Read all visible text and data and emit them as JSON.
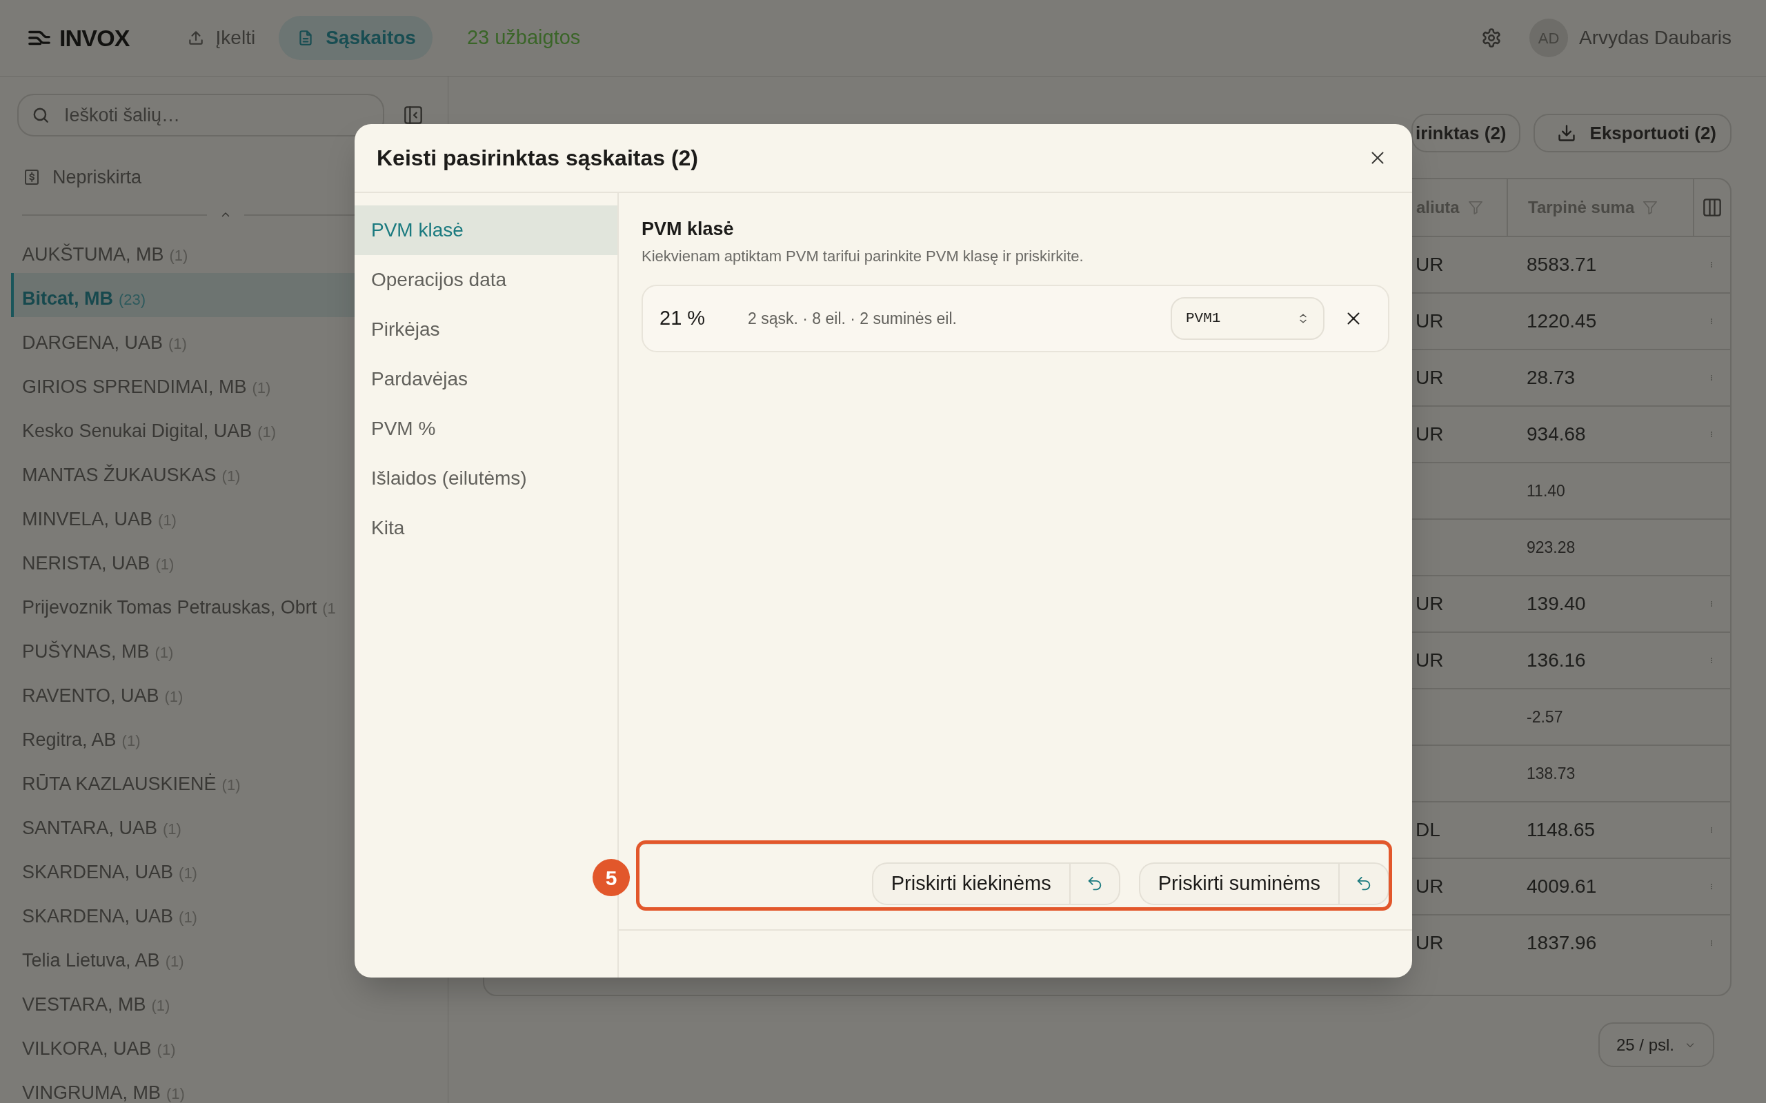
{
  "top_bar": {
    "logo": "INVOX",
    "nav": [
      {
        "label": "Įkelti",
        "kind": "upload",
        "selected": false
      },
      {
        "label": "Sąskaitos",
        "kind": "invoices",
        "selected": true
      }
    ],
    "status": "23 užbaigtos",
    "user": {
      "initials": "AD",
      "name": "Arvydas Daubaris"
    }
  },
  "sidebar": {
    "search": {
      "placeholder": "Ieškoti šalių…"
    },
    "unassigned": {
      "label": "Nepriskirta"
    },
    "items": [
      {
        "name": "AUKŠTUMA, MB",
        "count": "(1)",
        "selected": false
      },
      {
        "name": "Bitcat, MB",
        "count": "(23)",
        "selected": true
      },
      {
        "name": "DARGENA, UAB",
        "count": "(1)",
        "selected": false
      },
      {
        "name": "GIRIOS SPRENDIMAI, MB",
        "count": "(1)",
        "selected": false
      },
      {
        "name": "Kesko Senukai Digital, UAB",
        "count": "(1)",
        "selected": false
      },
      {
        "name": "MANTAS ŽUKAUSKAS",
        "count": "(1)",
        "selected": false
      },
      {
        "name": "MINVELA, UAB",
        "count": "(1)",
        "selected": false
      },
      {
        "name": "NERISTA, UAB",
        "count": "(1)",
        "selected": false
      },
      {
        "name": "Prijevoznik Tomas Petrauskas, Obrt",
        "count": "(1",
        "selected": false
      },
      {
        "name": "PUŠYNAS, MB",
        "count": "(1)",
        "selected": false
      },
      {
        "name": "RAVENTO, UAB",
        "count": "(1)",
        "selected": false
      },
      {
        "name": "Regitra, AB",
        "count": "(1)",
        "selected": false
      },
      {
        "name": "RŪTA KAZLAUSKIENĖ",
        "count": "(1)",
        "selected": false
      },
      {
        "name": "SANTARA, UAB",
        "count": "(1)",
        "selected": false
      },
      {
        "name": "SKARDENA, UAB",
        "count": "(1)",
        "selected": false
      },
      {
        "name": "SKARDENA, UAB",
        "count": "(1)",
        "selected": false
      },
      {
        "name": "Telia Lietuva, AB",
        "count": "(1)",
        "selected": false
      },
      {
        "name": "VESTARA, MB",
        "count": "(1)",
        "selected": false
      },
      {
        "name": "VILKORA, UAB",
        "count": "(1)",
        "selected": false
      },
      {
        "name": "VINGRUMA, MB",
        "count": "(1)",
        "selected": false
      }
    ]
  },
  "toolbar": {
    "buttons": [
      {
        "label": "irinktas (2)",
        "kind": "selection"
      },
      {
        "label": "Eksportuoti (2)",
        "kind": "export"
      }
    ]
  },
  "table": {
    "columns": [
      {
        "label": "aliuta"
      },
      {
        "label": "Tarpinė suma"
      }
    ],
    "rows": [
      {
        "kind": "invoice",
        "currency": "UR",
        "subtotal": "8583.71"
      },
      {
        "kind": "invoice",
        "currency": "UR",
        "subtotal": "1220.45"
      },
      {
        "kind": "invoice",
        "currency": "UR",
        "subtotal": "28.73"
      },
      {
        "kind": "invoice",
        "currency": "UR",
        "subtotal": "934.68"
      },
      {
        "kind": "line",
        "subtotal": "11.40"
      },
      {
        "kind": "line",
        "subtotal": "923.28"
      },
      {
        "kind": "invoice",
        "currency": "UR",
        "subtotal": "139.40"
      },
      {
        "kind": "invoice",
        "currency": "UR",
        "subtotal": "136.16"
      },
      {
        "kind": "line",
        "subtotal": "-2.57"
      },
      {
        "kind": "line",
        "subtotal": "138.73"
      },
      {
        "kind": "invoice",
        "currency": "DL",
        "subtotal": "1148.65"
      },
      {
        "kind": "invoice",
        "currency": "UR",
        "subtotal": "4009.61"
      },
      {
        "kind": "invoice",
        "currency": "UR",
        "subtotal": "1837.96"
      }
    ]
  },
  "pagination": {
    "page_size": "25 / psl."
  },
  "dialog": {
    "title": "Keisti pasirinktas sąskaitas (2)",
    "nav": [
      {
        "label": "PVM klasė",
        "selected": true
      },
      {
        "label": "Operacijos data",
        "selected": false
      },
      {
        "label": "Pirkėjas",
        "selected": false
      },
      {
        "label": "Pardavėjas",
        "selected": false
      },
      {
        "label": "PVM %",
        "selected": false
      },
      {
        "label": "Išlaidos (eilutėms)",
        "selected": false
      },
      {
        "label": "Kita",
        "selected": false
      }
    ],
    "section": {
      "title": "PVM klasė",
      "description": "Kiekvienam aptiktam PVM tarifui parinkite PVM klasę ir priskirkite.",
      "rates": [
        {
          "rate": "21 %",
          "summary": "2 sąsk. · 8 eil. · 2 suminės eil.",
          "vat_class": "PVM1"
        }
      ]
    },
    "actions": [
      {
        "label": "Priskirti kiekinėms"
      },
      {
        "label": "Priskirti suminėms"
      }
    ],
    "annotation": {
      "number": "5"
    }
  }
}
